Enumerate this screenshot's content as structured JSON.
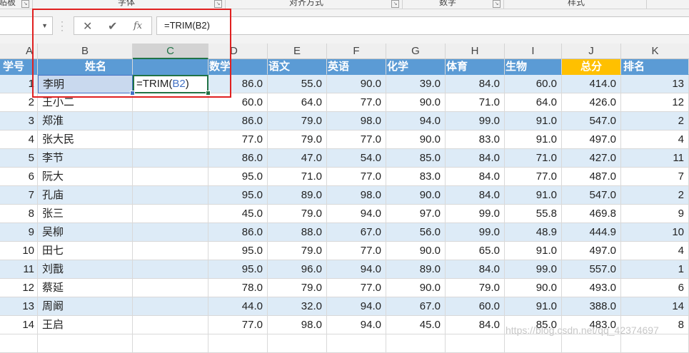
{
  "ribbon": {
    "groups": [
      "贴板",
      "字体",
      "对齐方式",
      "数字",
      "样式"
    ]
  },
  "formula_bar": {
    "name_box": "",
    "cancel_icon": "close-icon",
    "enter_icon": "checkmark-icon",
    "function_label": "fx",
    "formula": "=TRIM(B2)"
  },
  "columns": [
    "A",
    "B",
    "C",
    "D",
    "E",
    "F",
    "G",
    "H",
    "I",
    "J",
    "K"
  ],
  "header_row": {
    "id": "学号",
    "name": "姓名",
    "math": "数学",
    "chinese": "语文",
    "english": "英语",
    "chemistry": "化学",
    "pe": "体育",
    "biology": "生物",
    "total": "总分",
    "rank": "排名"
  },
  "active_cell": {
    "prefix": "=TRIM(",
    "ref": "B2",
    "suffix": ")"
  },
  "rows": [
    {
      "id": "1",
      "name": "李明",
      "math": "86.0",
      "chinese": "55.0",
      "english": "90.0",
      "chemistry": "39.0",
      "pe": "84.0",
      "biology": "60.0",
      "total": "414.0",
      "rank": "13"
    },
    {
      "id": "2",
      "name": "王小二",
      "math": "60.0",
      "chinese": "64.0",
      "english": "77.0",
      "chemistry": "90.0",
      "pe": "71.0",
      "biology": "64.0",
      "total": "426.0",
      "rank": "12"
    },
    {
      "id": "3",
      "name": "郑淮",
      "math": "86.0",
      "chinese": "79.0",
      "english": "98.0",
      "chemistry": "94.0",
      "pe": "99.0",
      "biology": "91.0",
      "total": "547.0",
      "rank": "2"
    },
    {
      "id": "4",
      "name": "张大民",
      "math": "77.0",
      "chinese": "79.0",
      "english": "77.0",
      "chemistry": "90.0",
      "pe": "83.0",
      "biology": "91.0",
      "total": "497.0",
      "rank": "4"
    },
    {
      "id": "5",
      "name": "李节",
      "math": "86.0",
      "chinese": "47.0",
      "english": "54.0",
      "chemistry": "85.0",
      "pe": "84.0",
      "biology": "71.0",
      "total": "427.0",
      "rank": "11"
    },
    {
      "id": "6",
      "name": "阮大",
      "math": "95.0",
      "chinese": "71.0",
      "english": "77.0",
      "chemistry": "83.0",
      "pe": "84.0",
      "biology": "77.0",
      "total": "487.0",
      "rank": "7"
    },
    {
      "id": "7",
      "name": "孔庙",
      "math": "95.0",
      "chinese": "89.0",
      "english": "98.0",
      "chemistry": "90.0",
      "pe": "84.0",
      "biology": "91.0",
      "total": "547.0",
      "rank": "2"
    },
    {
      "id": "8",
      "name": "张三",
      "math": "45.0",
      "chinese": "79.0",
      "english": "94.0",
      "chemistry": "97.0",
      "pe": "99.0",
      "biology": "55.8",
      "total": "469.8",
      "rank": "9"
    },
    {
      "id": "9",
      "name": "吴柳",
      "math": "86.0",
      "chinese": "88.0",
      "english": "67.0",
      "chemistry": "56.0",
      "pe": "99.0",
      "biology": "48.9",
      "total": "444.9",
      "rank": "10"
    },
    {
      "id": "10",
      "name": "田七",
      "math": "95.0",
      "chinese": "79.0",
      "english": "77.0",
      "chemistry": "90.0",
      "pe": "65.0",
      "biology": "91.0",
      "total": "497.0",
      "rank": "4"
    },
    {
      "id": "11",
      "name": "刘戬",
      "math": "95.0",
      "chinese": "96.0",
      "english": "94.0",
      "chemistry": "89.0",
      "pe": "84.0",
      "biology": "99.0",
      "total": "557.0",
      "rank": "1"
    },
    {
      "id": "12",
      "name": "蔡延",
      "math": "78.0",
      "chinese": "79.0",
      "english": "77.0",
      "chemistry": "90.0",
      "pe": "79.0",
      "biology": "90.0",
      "total": "493.0",
      "rank": "6"
    },
    {
      "id": "13",
      "name": "周阚",
      "math": "44.0",
      "chinese": "32.0",
      "english": "94.0",
      "chemistry": "67.0",
      "pe": "60.0",
      "biology": "91.0",
      "total": "388.0",
      "rank": "14"
    },
    {
      "id": "14",
      "name": "王启",
      "math": "77.0",
      "chinese": "98.0",
      "english": "94.0",
      "chemistry": "45.0",
      "pe": "84.0",
      "biology": "85.0",
      "total": "483.0",
      "rank": "8"
    }
  ],
  "watermark": "https://blog.csdn.net/qq_42374697",
  "colors": {
    "header_fill": "#5b9bd5",
    "band_fill": "#ddebf7",
    "total_header_fill": "#ffc000",
    "selection_green": "#217346",
    "highlight_box": "#e02020",
    "reference_blue": "#4472c4"
  }
}
